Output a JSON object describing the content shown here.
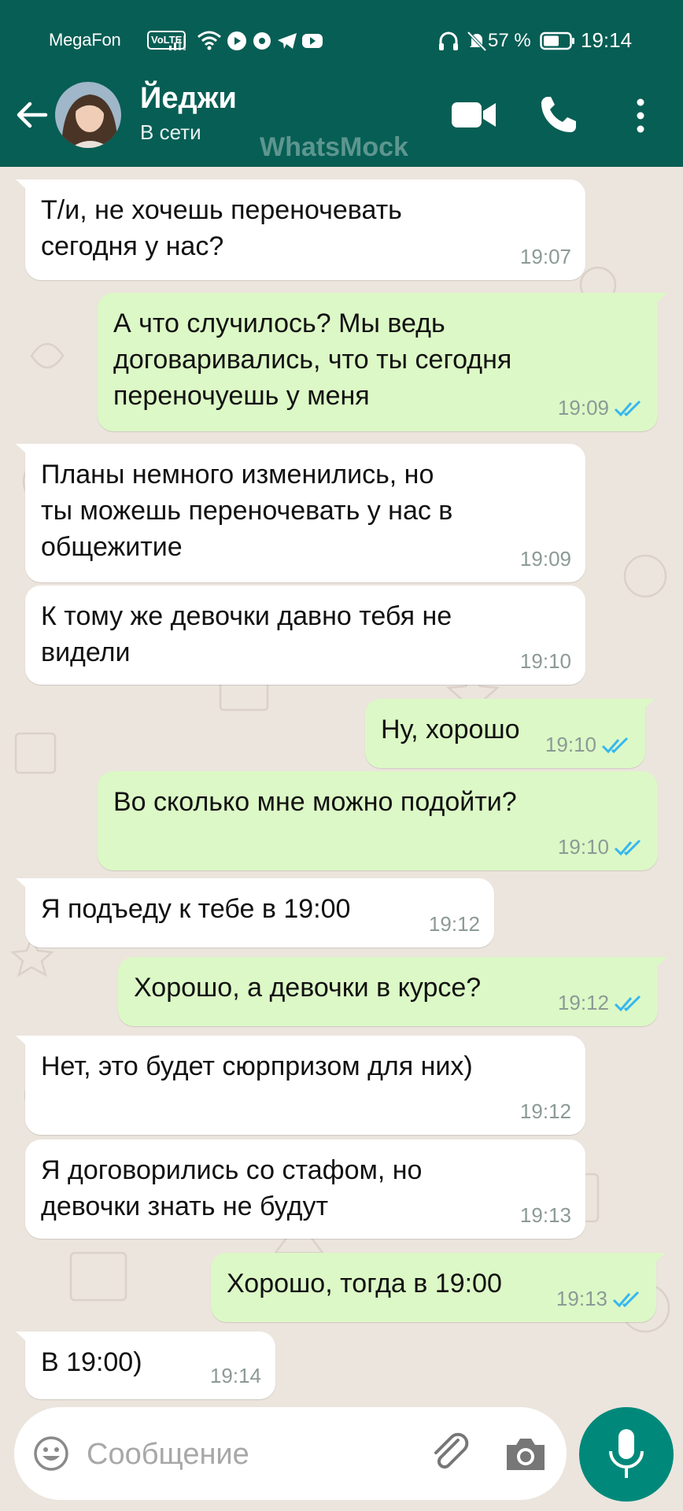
{
  "status_bar": {
    "carrier": "MegaFon",
    "network_badge": "VoLTE",
    "battery_percent": "57 %",
    "time": "19:14",
    "icons": [
      "signal-icon",
      "wifi-icon",
      "youtube-icon",
      "circle-app-icon",
      "telegram-icon",
      "youtube-icon",
      "headphones-icon",
      "bell-muted-icon",
      "battery-icon"
    ]
  },
  "header": {
    "name": "Йеджи",
    "status": "В сети",
    "watermark": "WhatsMock",
    "icons": [
      "back-arrow-icon",
      "video-call-icon",
      "phone-call-icon",
      "more-options-icon"
    ]
  },
  "messages": [
    {
      "dir": "in",
      "lines": [
        "Т/и, не хочешь переночевать",
        "сегодня у нас?"
      ],
      "time": "19:07",
      "tail": true
    },
    {
      "dir": "out",
      "lines": [
        "А что случилось? Мы ведь",
        "договаривались, что ты сегодня",
        "переночуешь у меня"
      ],
      "time": "19:09",
      "read": true,
      "tail": true
    },
    {
      "dir": "in",
      "lines": [
        "Планы немного изменились, но",
        "ты можешь переночевать у нас в",
        "общежитие"
      ],
      "time": "19:09",
      "tail": true
    },
    {
      "dir": "in",
      "lines": [
        "К тому же девочки давно тебя не",
        "видели"
      ],
      "time": "19:10"
    },
    {
      "dir": "out",
      "lines": [
        "Ну, хорошо"
      ],
      "time": "19:10",
      "read": true,
      "tail": true
    },
    {
      "dir": "out",
      "lines": [
        "Во сколько мне можно подойти?"
      ],
      "time": "19:10",
      "read": true
    },
    {
      "dir": "in",
      "lines": [
        "Я подъеду к тебе в 19:00"
      ],
      "time": "19:12",
      "tail": true
    },
    {
      "dir": "out",
      "lines": [
        "Хорошо, а девочки в курсе?"
      ],
      "time": "19:12",
      "read": true,
      "tail": true
    },
    {
      "dir": "in",
      "lines": [
        "Нет, это будет сюрпризом для них)"
      ],
      "time": "19:12",
      "tail": true
    },
    {
      "dir": "in",
      "lines": [
        "Я договорились со стафом, но",
        "девочки знать не будут"
      ],
      "time": "19:13"
    },
    {
      "dir": "out",
      "lines": [
        "Хорошо, тогда в 19:00"
      ],
      "time": "19:13",
      "read": true,
      "tail": true
    },
    {
      "dir": "in",
      "lines": [
        "В  19:00)"
      ],
      "time": "19:14",
      "tail": true
    }
  ],
  "input": {
    "placeholder": "Сообщение",
    "icons": [
      "emoji-icon",
      "attach-clip-icon",
      "camera-icon",
      "microphone-icon"
    ]
  },
  "colors": {
    "header": "#075e54",
    "chat_bg": "#ece5dd",
    "incoming_bubble": "#ffffff",
    "outgoing_bubble": "#dcf8c6",
    "read_ticks": "#34b7f1",
    "mic_button": "#00897b"
  }
}
